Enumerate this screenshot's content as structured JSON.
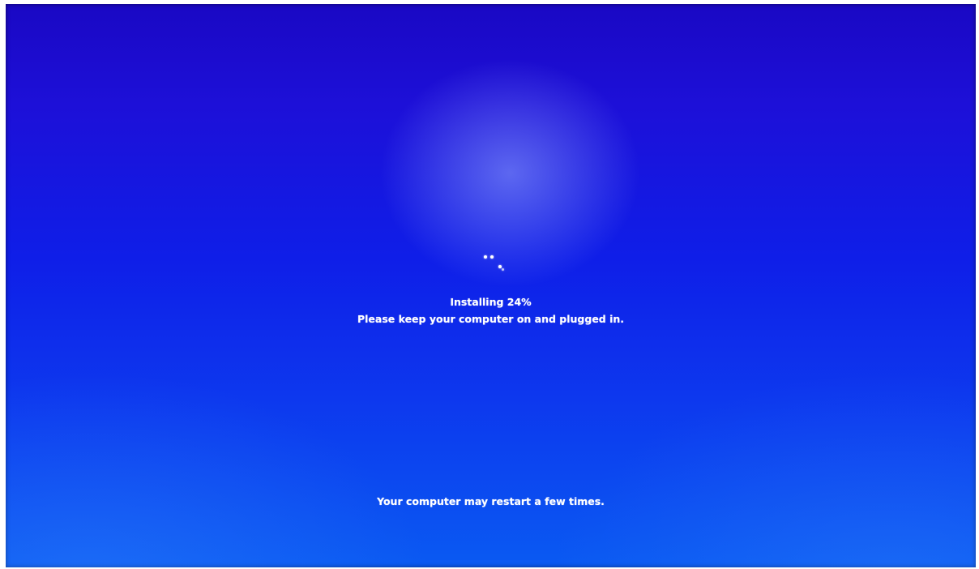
{
  "install": {
    "status_text": "Installing  24%",
    "progress_percent": 24,
    "keep_text": "Please keep your computer on and plugged in.",
    "restart_text": "Your computer may restart a few times."
  },
  "colors": {
    "background_top": "#1a08c4",
    "background_bottom": "#0a5af2",
    "text": "#ffffff"
  },
  "icons": {
    "spinner": "loading-spinner-icon"
  }
}
